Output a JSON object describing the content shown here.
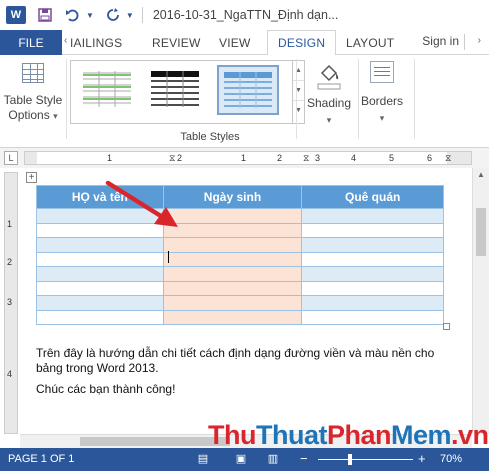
{
  "window": {
    "title": "2016-10-31_NgaTTN_Định dạn...",
    "app_icon": "W"
  },
  "tabs": {
    "file": "FILE",
    "items": [
      "MAILINGS",
      "REVIEW",
      "VIEW",
      "DESIGN",
      "LAYOUT"
    ],
    "mailings_visible": "IAILINGS",
    "active": "DESIGN",
    "signin": "Sign in"
  },
  "ribbon": {
    "table_style_options": "Table Style Options",
    "table_style_options_line1": "Table Style",
    "table_style_options_line2": "Options",
    "group_label": "Table Styles",
    "shading": "Shading",
    "borders": "Borders"
  },
  "ruler": {
    "numbers": [
      "1",
      "2",
      "1",
      "2",
      "3",
      "4",
      "5",
      "6"
    ]
  },
  "vertical_ruler": {
    "numbers": [
      "1",
      "2",
      "3",
      "4"
    ]
  },
  "table": {
    "headers": [
      "HỌ và tên",
      "Ngày sinh",
      "Quê quán"
    ],
    "row_count": 8
  },
  "document": {
    "para1": "Trên đây là hướng dẫn chi tiết cách định dạng đường viền và màu nền cho bảng trong Word 2013.",
    "para1_line1": "Trên đây là hướng dẫn chi tiết cách định dạng đường viền và màu nền cho",
    "para1_line2": "bảng trong Word 2013.",
    "para2": "Chúc các bạn thành công!"
  },
  "statusbar": {
    "page": "PAGE 1 OF 1",
    "zoom": "70%"
  },
  "watermark": {
    "part1": "Thu",
    "part2": "Thuat",
    "part3": "Phan",
    "part4": "Mem",
    "part5": ".vn"
  },
  "colors": {
    "accent": "#2b579a",
    "table_header": "#5b9bd5",
    "table_band": "#ddebf7",
    "shaded_column": "#fbe4d5",
    "arrow": "#d9262c"
  }
}
